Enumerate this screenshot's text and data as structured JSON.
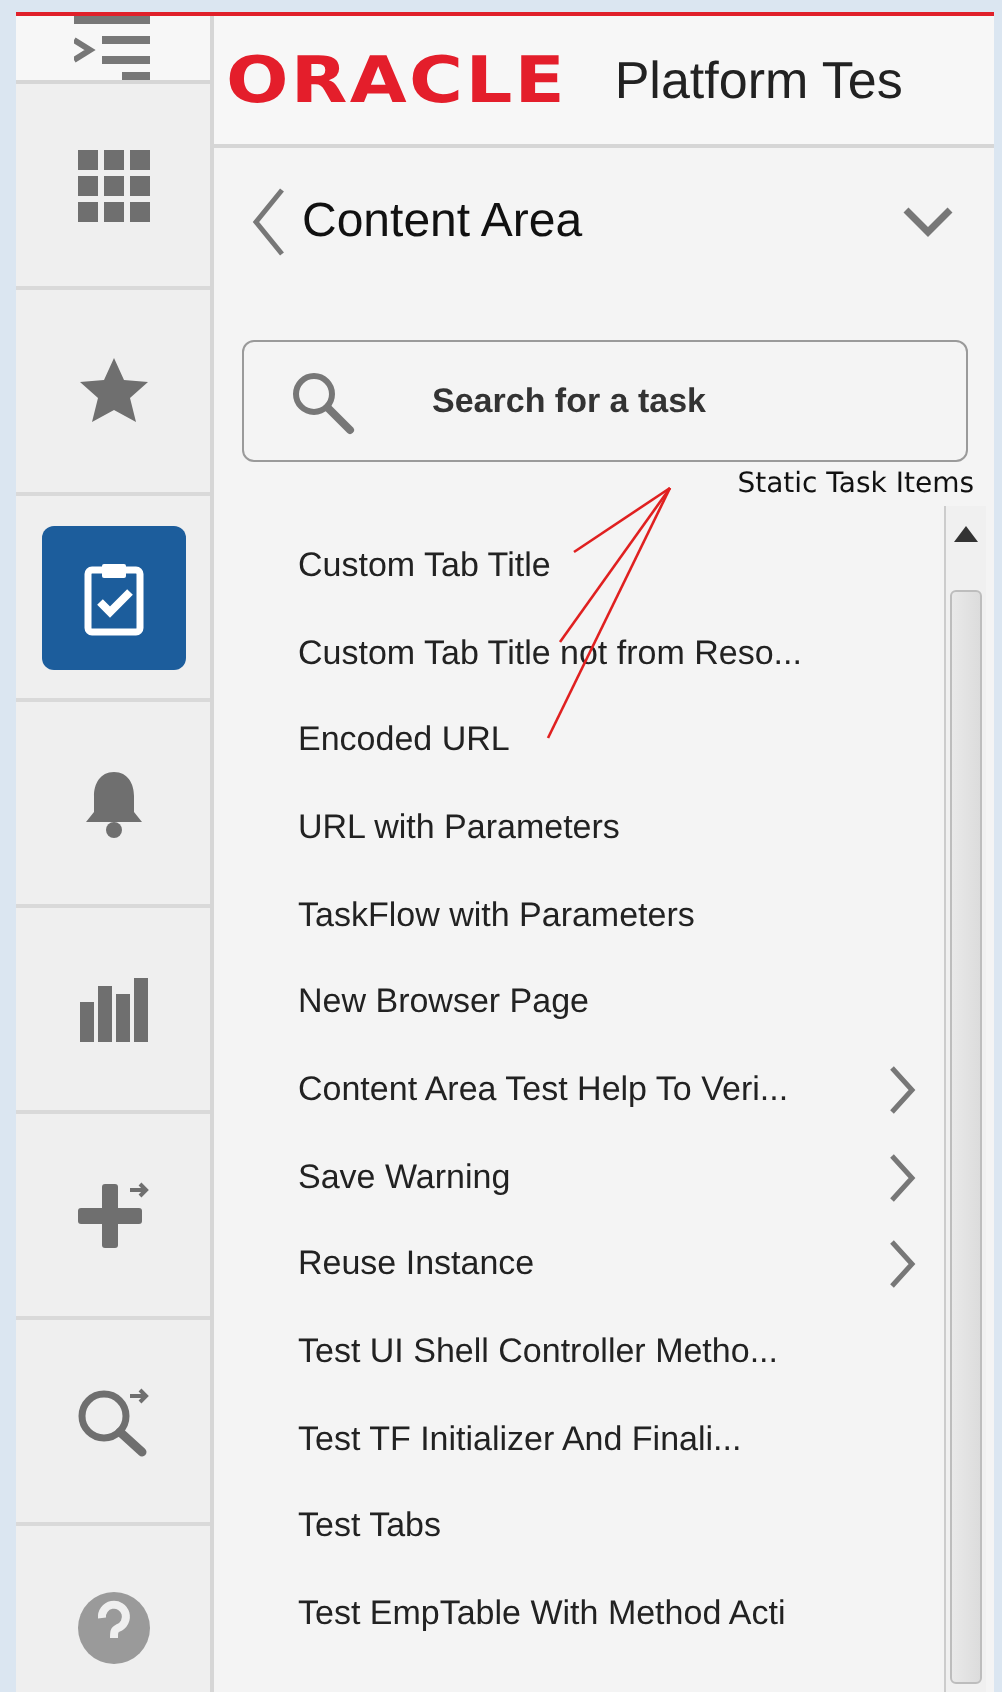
{
  "header": {
    "logo": "ORACLE",
    "title": "Platform Tes"
  },
  "rail": [
    {
      "kind": "grid",
      "selected": false
    },
    {
      "kind": "favorites",
      "selected": false
    },
    {
      "kind": "tasks",
      "selected": true
    },
    {
      "kind": "notifications",
      "selected": false
    },
    {
      "kind": "reports",
      "selected": false
    },
    {
      "kind": "add",
      "selected": false
    },
    {
      "kind": "search",
      "selected": false
    },
    {
      "kind": "help",
      "selected": false
    }
  ],
  "panel": {
    "title": "Content Area",
    "search": {
      "placeholder": "Search for a task"
    },
    "annotation": "Static Task Items",
    "items": [
      {
        "label": "Custom Tab Title",
        "submenu": false
      },
      {
        "label": "Custom Tab Title not from Reso...",
        "submenu": false
      },
      {
        "label": "Encoded URL",
        "submenu": false
      },
      {
        "label": "URL with Parameters",
        "submenu": false
      },
      {
        "label": "TaskFlow with Parameters",
        "submenu": false
      },
      {
        "label": "New Browser Page",
        "submenu": false
      },
      {
        "label": "Content Area Test Help To Veri...",
        "submenu": true
      },
      {
        "label": "Save Warning",
        "submenu": true
      },
      {
        "label": "Reuse Instance",
        "submenu": true
      },
      {
        "label": "Test UI Shell Controller Metho...",
        "submenu": false
      },
      {
        "label": "Test TF Initializer And Finali...",
        "submenu": false
      },
      {
        "label": "Test Tabs",
        "submenu": false
      },
      {
        "label": "Test EmpTable With Method Acti",
        "submenu": false
      }
    ]
  }
}
